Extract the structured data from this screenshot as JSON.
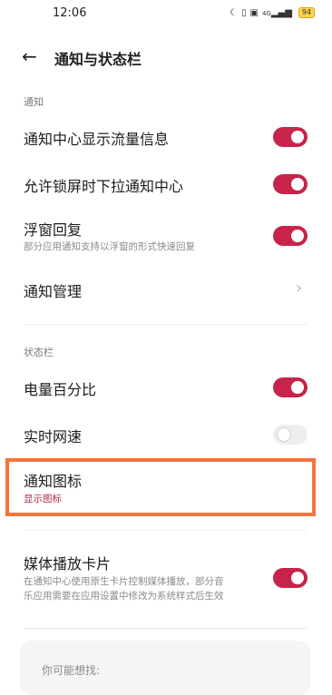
{
  "status_bar": {
    "time": "12:06",
    "icons": [
      "moon-icon",
      "vibrate-icon",
      "hd-icon",
      "signal-icon"
    ],
    "signal_label": "4G",
    "battery": "94"
  },
  "header": {
    "title": "通知与状态栏"
  },
  "sections": {
    "notifications_label": "通知",
    "statusbar_label": "状态栏"
  },
  "rows": {
    "traffic": {
      "title": "通知中心显示流量信息",
      "toggle_on": true
    },
    "lockscreen": {
      "title": "允许锁屏时下拉通知中心",
      "toggle_on": true
    },
    "floating": {
      "title": "浮窗回复",
      "subtitle": "部分应用通知支持以浮窗的形式快速回复",
      "toggle_on": true
    },
    "manage": {
      "title": "通知管理"
    },
    "battery_pct": {
      "title": "电量百分比",
      "toggle_on": true
    },
    "net_speed": {
      "title": "实时网速",
      "toggle_on": false
    },
    "notif_icons": {
      "title": "通知图标",
      "value": "显示图标"
    },
    "media_card": {
      "title": "媒体播放卡片",
      "subtitle_line1": "在通知中心使用原生卡片控制媒体播放，部分音",
      "subtitle_line2": "乐应用需要在应用设置中修改为系统样式后生效",
      "toggle_on": true
    }
  },
  "suggest": {
    "label": "你可能想找:"
  },
  "colors": {
    "accent": "#c8234a",
    "highlight": "#f4743e"
  }
}
